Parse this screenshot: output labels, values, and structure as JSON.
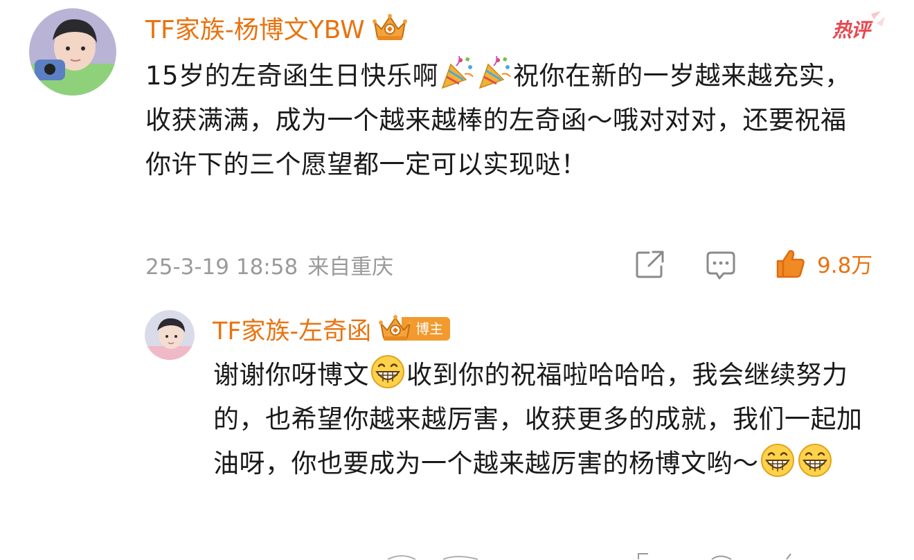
{
  "colors": {
    "username": "#e8730f",
    "text": "#1a1a1a",
    "meta": "#9a9a9a",
    "hot": "#e8474f",
    "like": "#e8730f",
    "badge": "#f29a2e"
  },
  "main_comment": {
    "username": "TF家族-杨博文YBW",
    "badge_icon": "crown-icon",
    "hot_label": "热评",
    "text_part1": "15岁的左奇函生日快乐啊",
    "emojis": [
      "party-popper-icon",
      "party-popper-icon"
    ],
    "text_part2": "祝你在新的一岁越来越充实，收获满满，成为一个越来越棒的左奇函～哦对对对，还要祝福你许下的三个愿望都一定可以实现哒！",
    "timestamp": "25-3-19 18:58",
    "location": "来自重庆",
    "actions": {
      "share_icon": "share-icon",
      "comment_icon": "comment-icon",
      "like_icon": "thumbs-up-icon",
      "like_count": "9.8万"
    }
  },
  "reply": {
    "username": "TF家族-左奇函",
    "badge_icon": "crown-icon",
    "badge_label": "博主",
    "text_part1": "谢谢你呀博文",
    "emoji_1": "grin-icon",
    "text_part2": "收到你的祝福啦哈哈哈，我会继续努力的，也希望你越来越厉害，收获更多的成就，我们一起加油呀，你也要成为一个越来越厉害的杨博文哟～",
    "trailing_emojis": [
      "grin-icon",
      "grin-icon"
    ]
  }
}
